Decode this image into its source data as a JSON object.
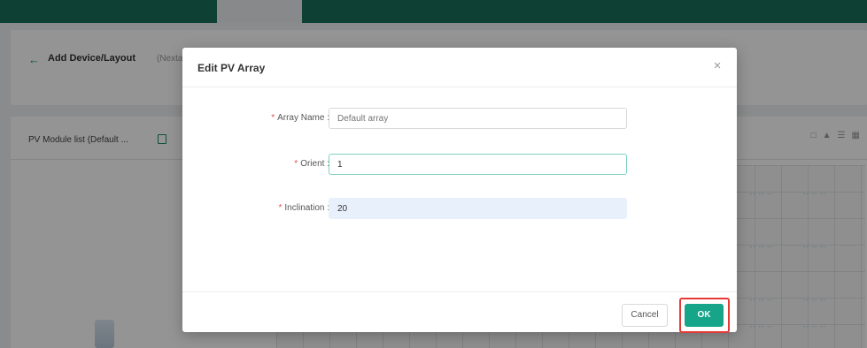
{
  "background": {
    "page_title": "Add Device/Layout",
    "page_subtitle": "(Nextam",
    "panel_title": "PV Module list (Default ...",
    "grid_cell_text": "-- -- --"
  },
  "modal": {
    "title": "Edit PV Array",
    "close_symbol": "×",
    "fields": [
      {
        "label": "Array Name :",
        "value": "",
        "placeholder": "Default array",
        "required_mark": "*"
      },
      {
        "label": "Orient :",
        "value": "1",
        "placeholder": "",
        "required_mark": "*"
      },
      {
        "label": "Inclination :",
        "value": "20",
        "placeholder": "",
        "required_mark": "*"
      }
    ],
    "buttons": {
      "cancel_label": "Cancel",
      "ok_label": "OK"
    }
  },
  "colors": {
    "accent": "#16a589",
    "highlight_box": "#e53935",
    "required": "#e64d4d",
    "topbar": "#1b6e5a"
  }
}
